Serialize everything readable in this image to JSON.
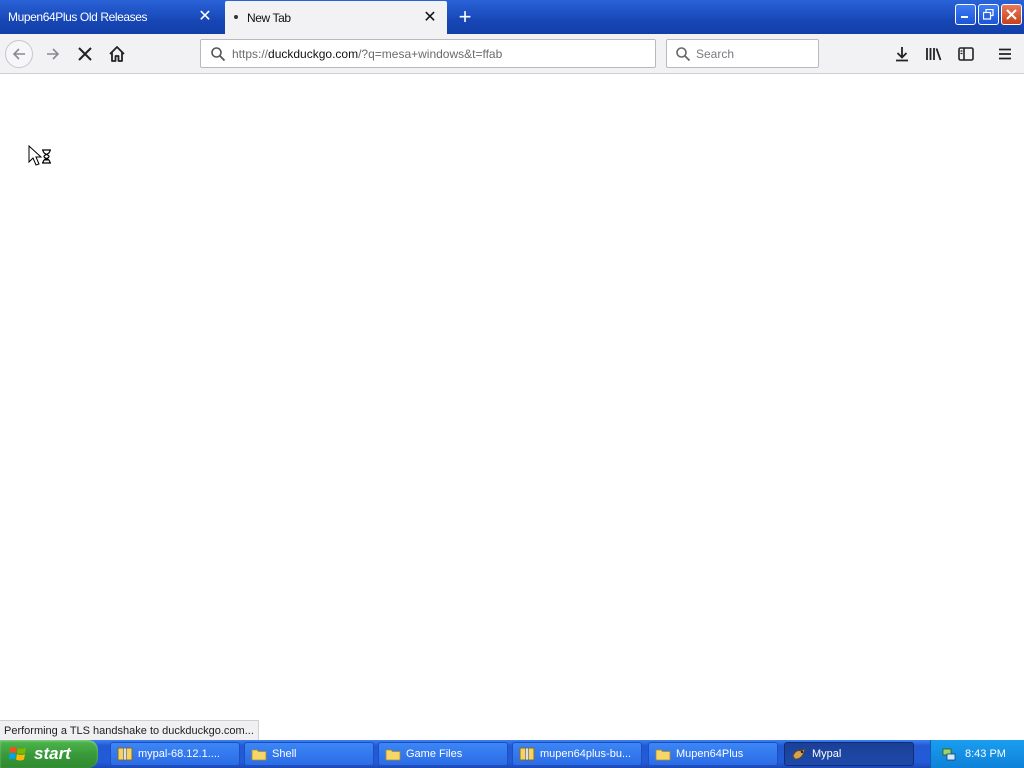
{
  "tabs": [
    {
      "label": "Mupen64Plus Old Releases",
      "close_glyph": "✕"
    },
    {
      "label": "New Tab",
      "close_glyph": "✕"
    }
  ],
  "newtab_glyph": "+",
  "window_controls": {
    "minimize": "▁",
    "maximize": "❐",
    "close": "✕"
  },
  "nav": {
    "url_prefix": "https://",
    "url_host": "duckduckgo.com",
    "url_rest": "/?q=mesa+windows&t=ffab",
    "search_placeholder": "Search"
  },
  "status_text": "Performing a TLS handshake to duckduckgo.com...",
  "taskbar": {
    "start_label": "start",
    "items": [
      {
        "label": "mypal-68.12.1....",
        "icon": "archive-icon"
      },
      {
        "label": "Shell",
        "icon": "folder-icon"
      },
      {
        "label": "Game Files",
        "icon": "folder-icon"
      },
      {
        "label": "mupen64plus-bu...",
        "icon": "archive-icon"
      },
      {
        "label": "Mupen64Plus",
        "icon": "folder-icon"
      },
      {
        "label": "Mypal",
        "icon": "mypal-icon"
      }
    ],
    "clock": "8:43 PM"
  },
  "colors": {
    "titlebar": "#1747b6",
    "toolbar": "#f2f2f4",
    "taskbar": "#225ad8",
    "start": "#3a9a3a",
    "tray": "#0e82d9"
  }
}
